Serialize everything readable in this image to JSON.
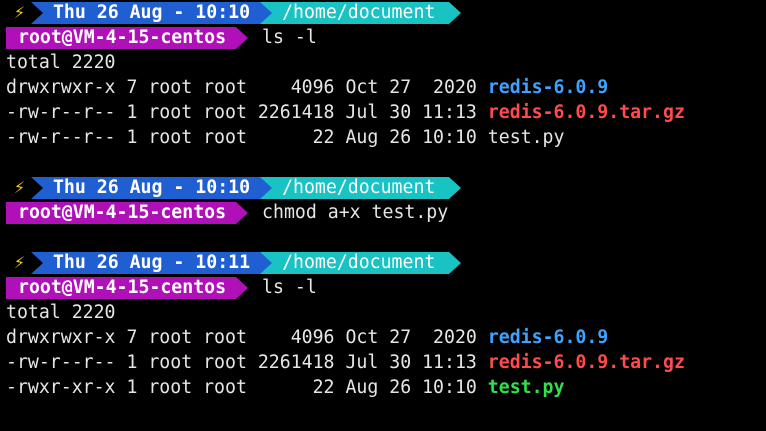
{
  "colors": {
    "background": "#000000",
    "text": "#e6e6e6",
    "bolt": "#f5c518",
    "date_segment": "#1f5fd1",
    "path_segment": "#19c3c3",
    "host_segment": "#b010b8",
    "directory": "#3fa2ff",
    "archive": "#ff4b4b",
    "executable": "#32e04a"
  },
  "icons": {
    "bolt": "⚡"
  },
  "blocks": [
    {
      "prompt": {
        "datetime": "Thu 26 Aug - 10:10",
        "path": "/home/document",
        "host": "root@VM-4-15-centos"
      },
      "command": "ls -l",
      "output_total": "total 2220",
      "rows": [
        {
          "meta": "drwxrwxr-x 7 root root    4096 Oct 27  2020 ",
          "name": "redis-6.0.9"
        },
        {
          "meta": "-rw-r--r-- 1 root root 2261418 Jul 30 11:13 ",
          "name": "redis-6.0.9.tar.gz"
        },
        {
          "meta": "-rw-r--r-- 1 root root      22 Aug 26 10:10 ",
          "name": "test.py"
        }
      ]
    },
    {
      "prompt": {
        "datetime": "Thu 26 Aug - 10:10",
        "path": "/home/document",
        "host": "root@VM-4-15-centos"
      },
      "command": "chmod a+x test.py"
    },
    {
      "prompt": {
        "datetime": "Thu 26 Aug - 10:11",
        "path": "/home/document",
        "host": "root@VM-4-15-centos"
      },
      "command": "ls -l",
      "output_total": "total 2220",
      "rows": [
        {
          "meta": "drwxrwxr-x 7 root root    4096 Oct 27  2020 ",
          "name": "redis-6.0.9"
        },
        {
          "meta": "-rw-r--r-- 1 root root 2261418 Jul 30 11:13 ",
          "name": "redis-6.0.9.tar.gz"
        },
        {
          "meta": "-rwxr-xr-x 1 root root      22 Aug 26 10:10 ",
          "name": "test.py"
        }
      ]
    }
  ]
}
